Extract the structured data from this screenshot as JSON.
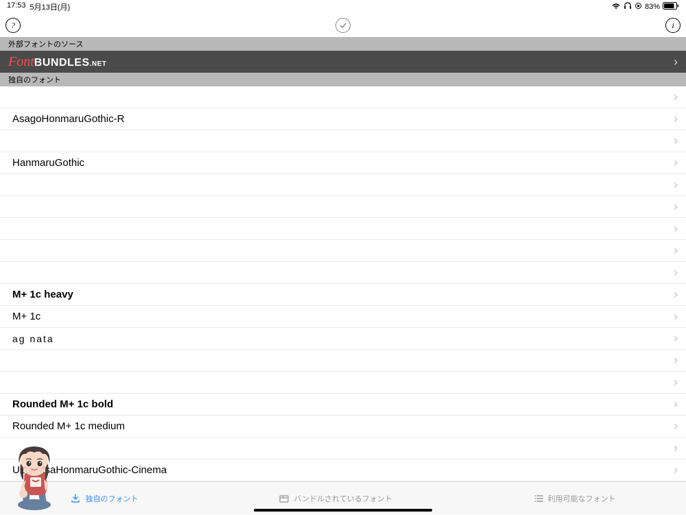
{
  "status": {
    "time": "17:53",
    "date": "5月13日(月)",
    "battery_pct": "83%"
  },
  "toolbar": {
    "help": "?",
    "info": "i"
  },
  "sections": {
    "external_sources": "外部フォントのソース",
    "own_fonts": "独自のフォント"
  },
  "banner": {
    "script": "Font",
    "bold": "BUNDLES",
    "suffix": ".NET"
  },
  "fonts": [
    {
      "label": "",
      "cls": ""
    },
    {
      "label": "AsagoHonmaruGothic-R",
      "cls": ""
    },
    {
      "label": "",
      "cls": ""
    },
    {
      "label": "HanmaruGothic",
      "cls": ""
    },
    {
      "label": "",
      "cls": ""
    },
    {
      "label": "",
      "cls": ""
    },
    {
      "label": "",
      "cls": ""
    },
    {
      "label": "",
      "cls": ""
    },
    {
      "label": "",
      "cls": ""
    },
    {
      "label": "M+ 1c heavy",
      "cls": "bold"
    },
    {
      "label": "M+ 1c",
      "cls": ""
    },
    {
      "label": "ag nata",
      "cls": "spaced"
    },
    {
      "label": "",
      "cls": ""
    },
    {
      "label": "",
      "cls": ""
    },
    {
      "label": "Rounded M+ 1c bold",
      "cls": "bold"
    },
    {
      "label": "Rounded M+ 1c medium",
      "cls": ""
    },
    {
      "label": "",
      "cls": ""
    },
    {
      "label": "UzumasaHonmaruGothic-Cinema",
      "cls": ""
    }
  ],
  "tabs": {
    "own": "独自のフォント",
    "bundled": "バンドルされているフォント",
    "available": "利用可能なフォント"
  }
}
